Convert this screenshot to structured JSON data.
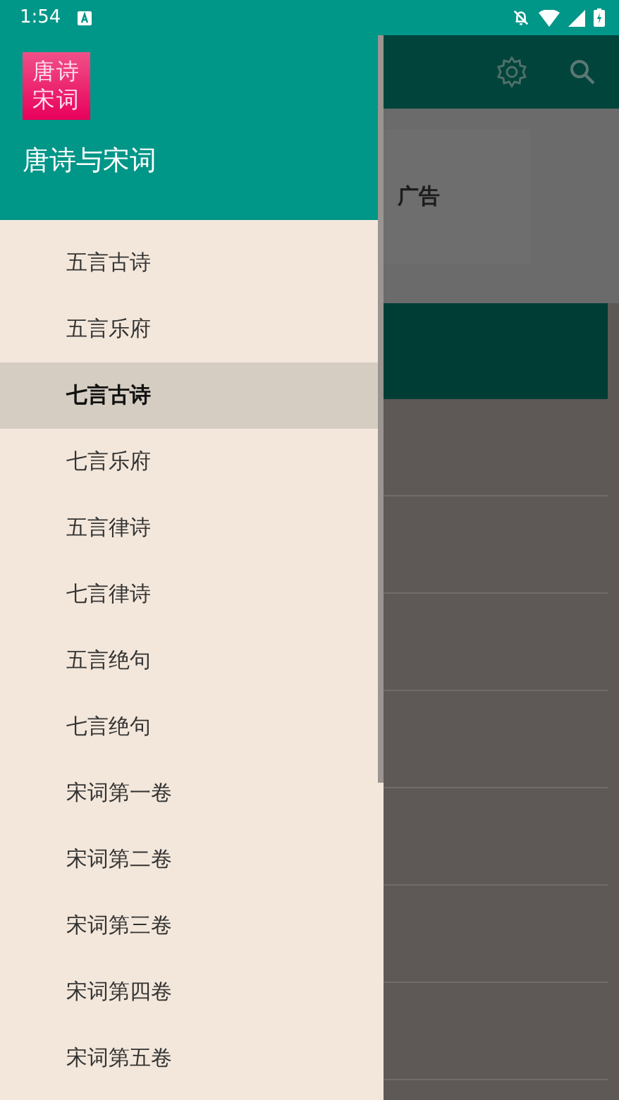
{
  "status_bar": {
    "time": "1:54"
  },
  "drawer": {
    "logo_lines": [
      "唐诗",
      "宋词"
    ],
    "title": "唐诗与宋词",
    "items": [
      {
        "label": "五言古诗",
        "selected": false
      },
      {
        "label": "五言乐府",
        "selected": false
      },
      {
        "label": "七言古诗",
        "selected": true
      },
      {
        "label": "七言乐府",
        "selected": false
      },
      {
        "label": "五言律诗",
        "selected": false
      },
      {
        "label": "七言律诗",
        "selected": false
      },
      {
        "label": "五言绝句",
        "selected": false
      },
      {
        "label": "七言绝句",
        "selected": false
      },
      {
        "label": "宋词第一卷",
        "selected": false
      },
      {
        "label": "宋词第二卷",
        "selected": false
      },
      {
        "label": "宋词第三卷",
        "selected": false
      },
      {
        "label": "宋词第四卷",
        "selected": false
      },
      {
        "label": "宋词第五卷",
        "selected": false
      }
    ]
  },
  "content": {
    "ad_text": "广告"
  }
}
